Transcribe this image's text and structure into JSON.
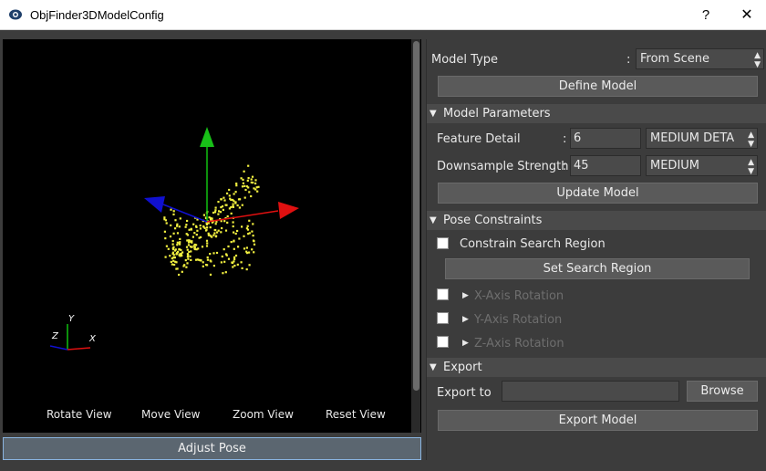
{
  "window": {
    "title": "ObjFinder3DModelConfig",
    "help_label": "?",
    "close_label": "✕"
  },
  "viewport": {
    "axis_labels": {
      "y": "Y",
      "z": "Z",
      "x": "X"
    },
    "buttons": [
      "Rotate View",
      "Move View",
      "Zoom View",
      "Reset View"
    ],
    "adjust_pose_label": "Adjust Pose"
  },
  "panel": {
    "model_type": {
      "label": "Model Type",
      "colon": ":",
      "value": "From Scene"
    },
    "define_model_label": "Define Model",
    "model_parameters": {
      "header": "Model Parameters",
      "feature_detail": {
        "label": "Feature Detail",
        "colon": ":",
        "value": "6",
        "preset": "MEDIUM DETA"
      },
      "downsample": {
        "label": "Downsample Strength",
        "colon": ":",
        "value": "45",
        "preset": "MEDIUM"
      },
      "update_label": "Update Model"
    },
    "pose_constraints": {
      "header": "Pose Constraints",
      "constrain_label": "Constrain Search Region",
      "set_region_label": "Set Search Region",
      "rotations": [
        "X-Axis Rotation",
        "Y-Axis Rotation",
        "Z-Axis Rotation"
      ]
    },
    "export": {
      "header": "Export",
      "export_to_label": "Export to",
      "path_value": "",
      "browse_label": "Browse",
      "export_model_label": "Export Model"
    }
  },
  "colors": {
    "axis_x": "#e01010",
    "axis_y": "#10c010",
    "axis_z": "#1010d0",
    "points": "#f2f040",
    "accent_border": "#8ab4e0"
  }
}
